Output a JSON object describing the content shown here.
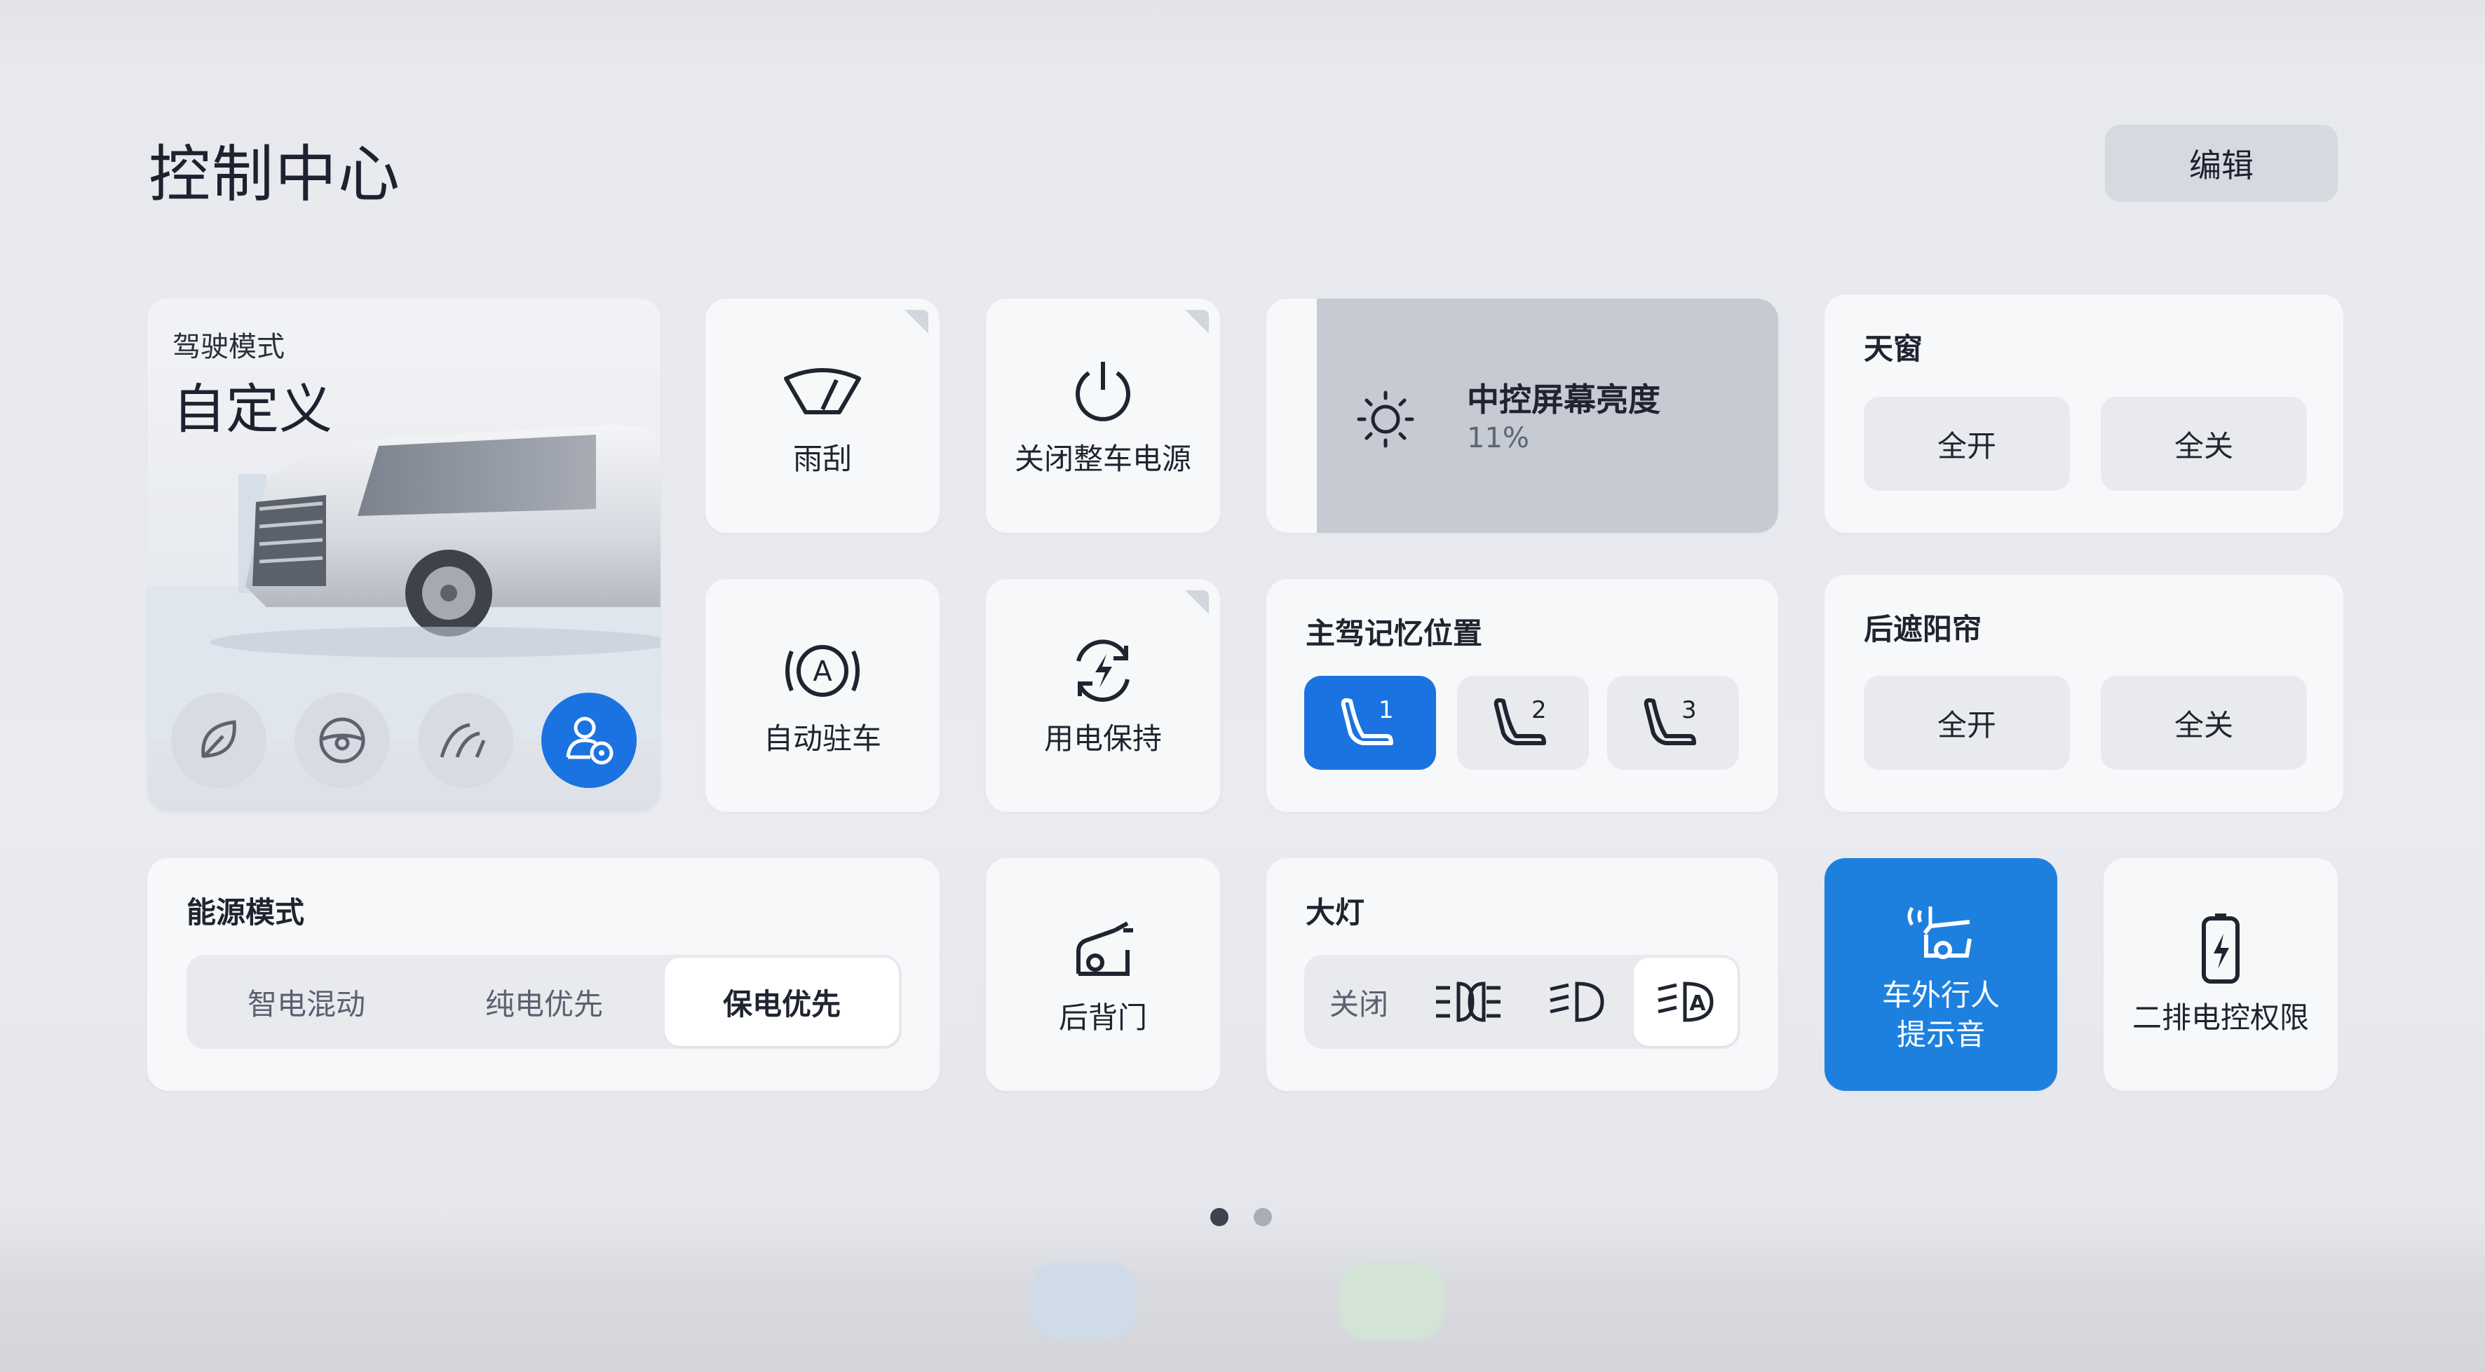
{
  "page": {
    "title": "控制中心",
    "edit_label": "编辑"
  },
  "drive_mode": {
    "label": "驾驶模式",
    "value": "自定义",
    "modes": [
      {
        "icon": "leaf-icon",
        "active": false
      },
      {
        "icon": "steering-wheel-icon",
        "active": false
      },
      {
        "icon": "terrain-icon",
        "active": false
      },
      {
        "icon": "custom-driver-icon",
        "active": true
      }
    ]
  },
  "tiles": {
    "wiper": "雨刮",
    "power_off": "关闭整车电源",
    "auto_hold": "自动驻车",
    "power_keep": "用电保持",
    "tailgate": "后背门",
    "pedestrian_alert": "车外行人\n提示音",
    "rear_control": "二排电控权限"
  },
  "brightness": {
    "title": "中控屏幕亮度",
    "value_text": "11%",
    "level": 0.11
  },
  "sunroof": {
    "title": "天窗",
    "open": "全开",
    "close": "全关"
  },
  "rear_shade": {
    "title": "后遮阳帘",
    "open": "全开",
    "close": "全关"
  },
  "seat_memory": {
    "title": "主驾记忆位置",
    "positions": [
      {
        "num": "1",
        "active": true
      },
      {
        "num": "2",
        "active": false
      },
      {
        "num": "3",
        "active": false
      }
    ]
  },
  "energy_mode": {
    "title": "能源模式",
    "options": [
      {
        "label": "智电混动",
        "active": false
      },
      {
        "label": "纯电优先",
        "active": false
      },
      {
        "label": "保电优先",
        "active": true
      }
    ]
  },
  "headlight": {
    "title": "大灯",
    "off_label": "关闭",
    "options": [
      "position-light-icon",
      "low-beam-icon",
      "auto-headlight-icon"
    ],
    "active_index": 3
  },
  "pagination": {
    "total": 2,
    "current": 0
  },
  "colors": {
    "accent": "#1a73e0",
    "blue_card": "#1e80de",
    "card": "#f7f8fa"
  }
}
